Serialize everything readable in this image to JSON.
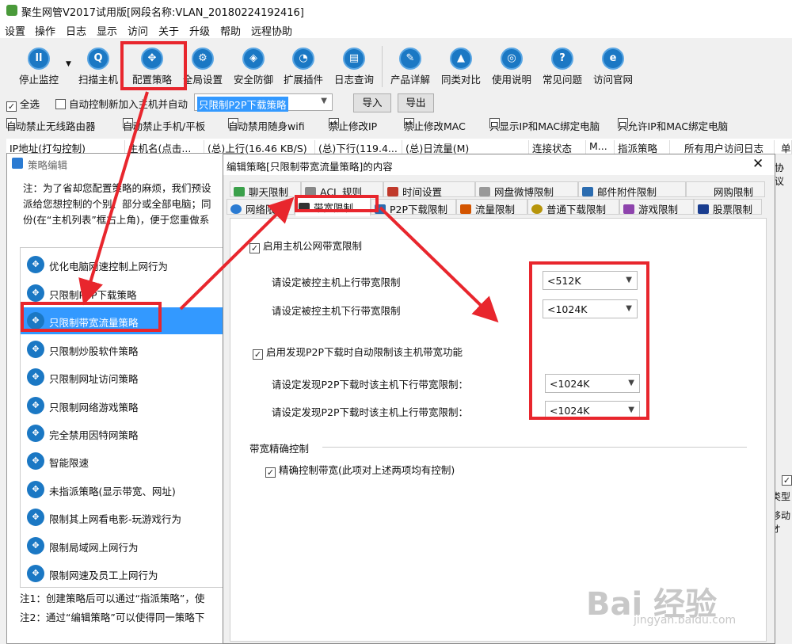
{
  "app": {
    "title": "聚生网管V2017试用版[网段名称:VLAN_20180224192416]"
  },
  "menu": [
    "设置",
    "操作",
    "日志",
    "显示",
    "访问",
    "关于",
    "升级",
    "帮助",
    "远程协助"
  ],
  "toolbar": [
    {
      "label": "停止监控",
      "icon": "pause-icon"
    },
    {
      "label": "扫描主机",
      "icon": "scan-icon"
    },
    {
      "label": "配置策略",
      "icon": "policy-icon"
    },
    {
      "label": "全局设置",
      "icon": "gear-icon"
    },
    {
      "label": "安全防御",
      "icon": "shield-icon"
    },
    {
      "label": "扩展插件",
      "icon": "plugin-icon"
    },
    {
      "label": "日志查询",
      "icon": "log-icon"
    },
    {
      "label": "产品详解",
      "icon": "product-icon"
    },
    {
      "label": "同类对比",
      "icon": "compare-icon"
    },
    {
      "label": "使用说明",
      "icon": "help-icon"
    },
    {
      "label": "常见问题",
      "icon": "question-icon"
    },
    {
      "label": "访问官网",
      "icon": "ie-icon"
    }
  ],
  "options1": {
    "select_all": "全选",
    "auto_control": "自动控制新加入主机并自动",
    "policy_combo": "只限制P2P下载策略",
    "import": "导入",
    "export": "导出"
  },
  "options2": [
    "自动禁止无线路由器",
    "自动禁止手机/平板",
    "自动禁用随身wifi",
    "禁止修改IP",
    "禁止修改MAC",
    "只显示IP和MAC绑定电脑",
    "只允许IP和MAC绑定电脑"
  ],
  "columns": [
    "IP地址(打勾控制)",
    "主机名(点击...",
    "(总)上行(16.46 KB/S)",
    "(总)下行(119.4...",
    "(总)日流量(M)",
    "连接状态",
    "M...",
    "指派策略",
    "所有用户访问日志",
    "单"
  ],
  "right_fragments": {
    "protocol": "协议",
    "type": "类型",
    "move": "移动オ"
  },
  "strategy_window": {
    "title": "策略编辑",
    "note_lines": [
      "注：为了省却您配置策略的麻烦，我们预设",
      "派给您想控制的个别、部分或全部电脑；同",
      "份(在“主机列表”框右上角)，便于您重做系"
    ],
    "items": [
      "优化电脑网速控制上网行为",
      "只限制P2P下载策略",
      "只限制带宽流量策略",
      "只限制炒股软件策略",
      "只限制网址访问策略",
      "只限制网络游戏策略",
      "完全禁用因特网策略",
      "智能限速",
      "未指派策略(显示带宽、网址)",
      "限制其上网看电影-玩游戏行为",
      "限制局域网上网行为",
      "限制网速及员工上网行为"
    ],
    "footnotes": [
      "注1：创建策略后可以通过“指派策略”，使",
      "注2：通过“编辑策略”可以使得同一策略下"
    ]
  },
  "edit_dialog": {
    "title": "编辑策略[只限制带宽流量策略]的内容",
    "tabs_row1": [
      "聊天限制",
      "ACL 规则",
      "时间设置",
      "网盘微博限制",
      "邮件附件限制",
      "网购限制"
    ],
    "tabs_row2": [
      "网络限制",
      "带宽限制",
      "P2P下载限制",
      "流量限制",
      "普通下载限制",
      "游戏限制",
      "股票限制"
    ],
    "enable_public": "启用主机公网带宽限制",
    "up_label": "请设定被控主机上行带宽限制",
    "up_value": "<512K",
    "down_label": "请设定被控主机下行带宽限制",
    "down_value": "<1024K",
    "enable_p2p": "启用发现P2P下载时自动限制该主机带宽功能",
    "p2p_down_label": "请设定发现P2P下载时该主机下行带宽限制：",
    "p2p_down_value": "<1024K",
    "p2p_up_label": "请设定发现P2P下载时该主机上行带宽限制：",
    "p2p_up_value": "<1024K",
    "precise_group": "带宽精确控制",
    "precise_check": "精确控制带宽(此项对上述两项均有控制)"
  },
  "watermark": {
    "logo": "Bai 经验",
    "url": "jingyan.baidu.com"
  },
  "colors": {
    "annotation": "#e8262d",
    "selection": "#3399ff",
    "icon": "#1b78c4"
  }
}
